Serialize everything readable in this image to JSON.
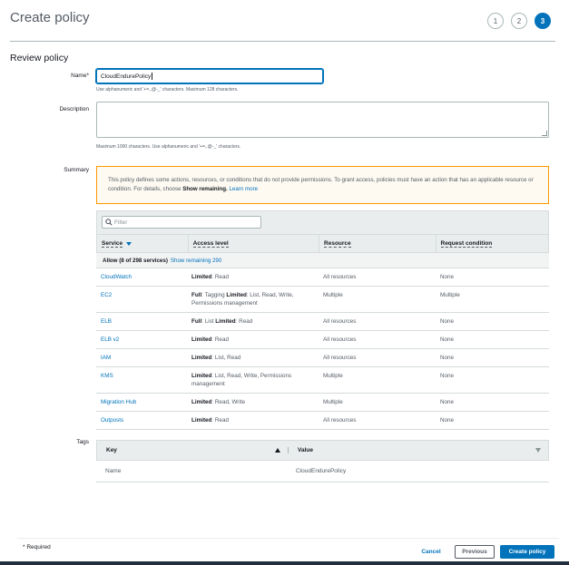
{
  "header": {
    "title": "Create policy",
    "steps": [
      "1",
      "2",
      "3"
    ]
  },
  "review": {
    "section_title": "Review policy",
    "name_label": "Name*",
    "name_value": "CloudEndurePolicy",
    "name_hint": "Use alphanumeric and '+=,.@-_' characters. Maximum 128 characters.",
    "description_label": "Description",
    "description_hint": "Maximum 1000 characters. Use alphanumeric and '+=,.@-_' characters.",
    "summary_label": "Summary"
  },
  "warning": {
    "text": "This policy defines some actions, resources, or conditions that do not provide permissions. To grant access, policies must have an action that has an applicable resource or condition. For details, choose ",
    "bold": "Show remaining.",
    "link": "Learn more"
  },
  "summary_table": {
    "filter_placeholder": "Filter",
    "columns": [
      "Service",
      "Access level",
      "Resource",
      "Request condition"
    ],
    "allow_label": "Allow (8 of 298 services)",
    "show_remaining": "Show remaining 290",
    "rows": [
      {
        "service": "CloudWatch",
        "level_bold": "Limited",
        "level_text": ": Read",
        "level_bold2": "",
        "level_text2": "",
        "resource": "All resources",
        "condition": "None"
      },
      {
        "service": "EC2",
        "level_bold": "Full",
        "level_text": ": Tagging ",
        "level_bold2": "Limited",
        "level_text2": ": List, Read, Write, Permissions management",
        "resource": "Multiple",
        "condition": "Multiple"
      },
      {
        "service": "ELB",
        "level_bold": "Full",
        "level_text": ": List ",
        "level_bold2": "Limited",
        "level_text2": ": Read",
        "resource": "All resources",
        "condition": "None"
      },
      {
        "service": "ELB v2",
        "level_bold": "Limited",
        "level_text": ": Read",
        "level_bold2": "",
        "level_text2": "",
        "resource": "All resources",
        "condition": "None"
      },
      {
        "service": "IAM",
        "level_bold": "Limited",
        "level_text": ": List, Read",
        "level_bold2": "",
        "level_text2": "",
        "resource": "All resources",
        "condition": "None"
      },
      {
        "service": "KMS",
        "level_bold": "Limited",
        "level_text": ": List, Read, Write, Permissions management",
        "level_bold2": "",
        "level_text2": "",
        "resource": "Multiple",
        "condition": "None"
      },
      {
        "service": "Migration Hub",
        "level_bold": "Limited",
        "level_text": ": Read, Write",
        "level_bold2": "",
        "level_text2": "",
        "resource": "Multiple",
        "condition": "None"
      },
      {
        "service": "Outposts",
        "level_bold": "Limited",
        "level_text": ": Read",
        "level_bold2": "",
        "level_text2": "",
        "resource": "All resources",
        "condition": "None"
      }
    ]
  },
  "tags": {
    "label": "Tags",
    "key_header": "Key",
    "value_header": "Value",
    "rows": [
      {
        "key": "Name",
        "value": "CloudEndurePolicy"
      }
    ]
  },
  "footer": {
    "required": "* Required",
    "cancel": "Cancel",
    "previous": "Previous",
    "create": "Create policy"
  },
  "colors": {
    "accent": "#0073bb",
    "warning_border": "#ff9900",
    "link": "#0073bb"
  }
}
